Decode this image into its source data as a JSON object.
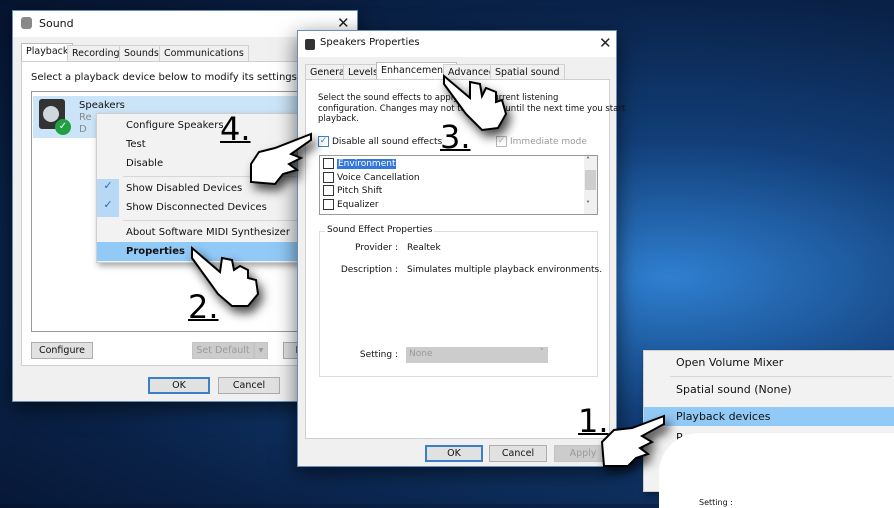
{
  "sound_dialog": {
    "title": "Sound",
    "tabs": [
      "Playback",
      "Recording",
      "Sounds",
      "Communications"
    ],
    "active_tab": "Playback",
    "instruction": "Select a playback device below to modify its settings:",
    "device": {
      "name": "Speakers",
      "line2": "Re",
      "line3": "D",
      "status": "default-check"
    },
    "buttons": {
      "configure": "Configure",
      "set_default": "Set Default",
      "properties": "Pro",
      "ok": "OK",
      "cancel": "Cancel"
    }
  },
  "device_menu": {
    "items": [
      "Configure Speakers",
      "Test",
      "Disable",
      "Show Disabled Devices",
      "Show Disconnected Devices",
      "About Software MIDI Synthesizer",
      "Properties"
    ],
    "checked": [
      "Show Disabled Devices",
      "Show Disconnected Devices"
    ],
    "highlighted": "Properties"
  },
  "properties_dialog": {
    "title": "Speakers Properties",
    "tabs": [
      "General",
      "Levels",
      "Enhancements",
      "Advanced",
      "Spatial sound"
    ],
    "active_tab": "Enhancements",
    "description_lines": [
      "Select the sound effects to apply to the current listening",
      "configuration. Changes may not take effect until the next time you start",
      "playback."
    ],
    "disable_all_label": "Disable all sound effects",
    "disable_all_checked": true,
    "immediate_mode_label": "Immediate mode",
    "immediate_mode_checked": true,
    "effects": [
      "Environment",
      "Voice Cancellation",
      "Pitch Shift",
      "Equalizer"
    ],
    "selected_effect": "Environment",
    "group_title": "Sound Effect Properties",
    "provider_label": "Provider :",
    "provider_value": "Realtek",
    "description_label": "Description :",
    "description_value": "Simulates multiple playback environments.",
    "setting_label": "Setting :",
    "setting_value": "None",
    "buttons": {
      "ok": "OK",
      "cancel": "Cancel",
      "apply": "Apply"
    }
  },
  "tray_menu": {
    "items": [
      "Open Volume Mixer",
      "Spatial sound (None)",
      "Playback devices",
      "R"
    ],
    "highlighted": "Playback devices",
    "footer_setting_label": "Setting :"
  },
  "steps": [
    "1.",
    "2.",
    "3.",
    "4."
  ]
}
